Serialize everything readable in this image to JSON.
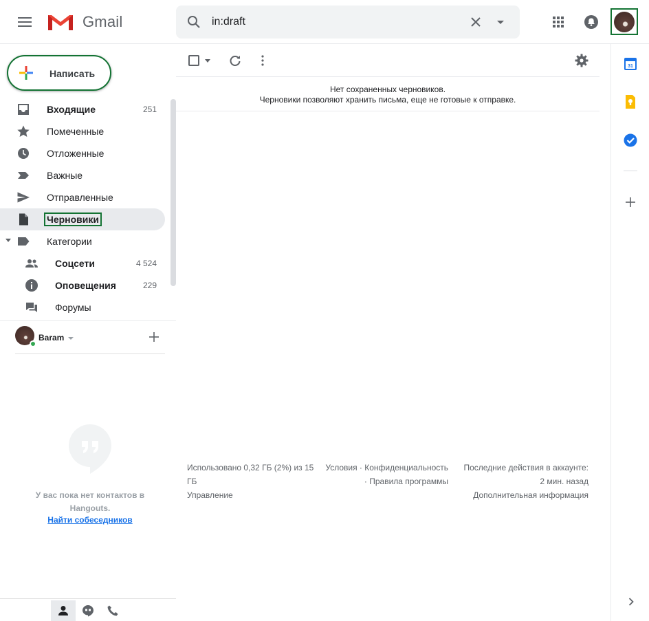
{
  "header": {
    "app_name": "Gmail",
    "search": {
      "value": "in:draft",
      "placeholder": ""
    }
  },
  "compose": {
    "label": "Написать"
  },
  "nav": {
    "items": [
      {
        "label": "Входящие",
        "count": "251",
        "icon": "inbox-icon"
      },
      {
        "label": "Помеченные",
        "count": "",
        "icon": "star-icon"
      },
      {
        "label": "Отложенные",
        "count": "",
        "icon": "clock-icon"
      },
      {
        "label": "Важные",
        "count": "",
        "icon": "important-icon"
      },
      {
        "label": "Отправленные",
        "count": "",
        "icon": "send-icon"
      },
      {
        "label": "Черновики",
        "count": "",
        "icon": "draft-icon"
      },
      {
        "label": "Категории",
        "count": "",
        "icon": "label-icon"
      }
    ],
    "categories": [
      {
        "label": "Соцсети",
        "count": "4 524",
        "icon": "people-icon"
      },
      {
        "label": "Оповещения",
        "count": "229",
        "icon": "info-icon"
      },
      {
        "label": "Форумы",
        "count": "",
        "icon": "forum-icon"
      }
    ]
  },
  "hangouts": {
    "user_name": "Baram",
    "empty_text": "У вас пока нет контактов в Hangouts.",
    "find_link": "Найти собеседников"
  },
  "main": {
    "empty_title": "Нет сохраненных черновиков.",
    "empty_subtitle": "Черновики позволяют хранить письма, еще не готовые к отправке."
  },
  "footer": {
    "storage_line1": "Использовано 0,32 ГБ (2%) из 15",
    "storage_line2": "ГБ",
    "manage": "Управление",
    "terms": "Условия",
    "privacy": "Конфиденциальность",
    "program_policies": "Правила программы",
    "last_activity": "Последние действия в аккаунте:",
    "last_activity_time": "2 мин. назад",
    "details": "Дополнительная информация"
  },
  "colors": {
    "accent_green_outline": "#137333",
    "active_bg": "#e8eaed",
    "link_blue": "#1a73e8",
    "status_green": "#34a853"
  }
}
